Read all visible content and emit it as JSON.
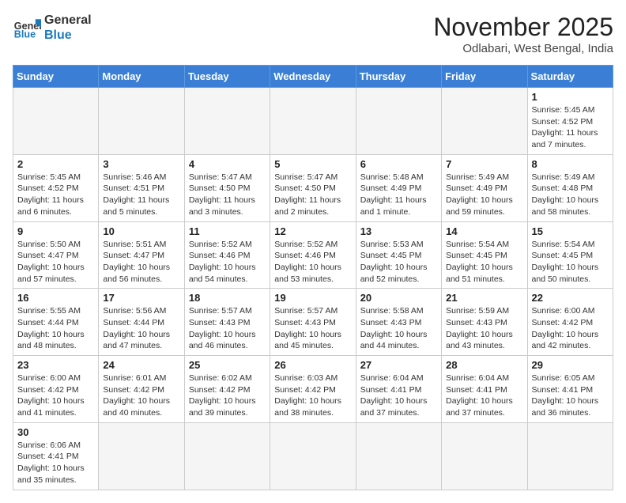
{
  "header": {
    "logo_general": "General",
    "logo_blue": "Blue",
    "month_title": "November 2025",
    "location": "Odlabari, West Bengal, India"
  },
  "weekdays": [
    "Sunday",
    "Monday",
    "Tuesday",
    "Wednesday",
    "Thursday",
    "Friday",
    "Saturday"
  ],
  "days": [
    {
      "num": "",
      "info": ""
    },
    {
      "num": "",
      "info": ""
    },
    {
      "num": "",
      "info": ""
    },
    {
      "num": "",
      "info": ""
    },
    {
      "num": "",
      "info": ""
    },
    {
      "num": "",
      "info": ""
    },
    {
      "num": "1",
      "info": "Sunrise: 5:45 AM\nSunset: 4:52 PM\nDaylight: 11 hours\nand 7 minutes."
    },
    {
      "num": "2",
      "info": "Sunrise: 5:45 AM\nSunset: 4:52 PM\nDaylight: 11 hours\nand 6 minutes."
    },
    {
      "num": "3",
      "info": "Sunrise: 5:46 AM\nSunset: 4:51 PM\nDaylight: 11 hours\nand 5 minutes."
    },
    {
      "num": "4",
      "info": "Sunrise: 5:47 AM\nSunset: 4:50 PM\nDaylight: 11 hours\nand 3 minutes."
    },
    {
      "num": "5",
      "info": "Sunrise: 5:47 AM\nSunset: 4:50 PM\nDaylight: 11 hours\nand 2 minutes."
    },
    {
      "num": "6",
      "info": "Sunrise: 5:48 AM\nSunset: 4:49 PM\nDaylight: 11 hours\nand 1 minute."
    },
    {
      "num": "7",
      "info": "Sunrise: 5:49 AM\nSunset: 4:49 PM\nDaylight: 10 hours\nand 59 minutes."
    },
    {
      "num": "8",
      "info": "Sunrise: 5:49 AM\nSunset: 4:48 PM\nDaylight: 10 hours\nand 58 minutes."
    },
    {
      "num": "9",
      "info": "Sunrise: 5:50 AM\nSunset: 4:47 PM\nDaylight: 10 hours\nand 57 minutes."
    },
    {
      "num": "10",
      "info": "Sunrise: 5:51 AM\nSunset: 4:47 PM\nDaylight: 10 hours\nand 56 minutes."
    },
    {
      "num": "11",
      "info": "Sunrise: 5:52 AM\nSunset: 4:46 PM\nDaylight: 10 hours\nand 54 minutes."
    },
    {
      "num": "12",
      "info": "Sunrise: 5:52 AM\nSunset: 4:46 PM\nDaylight: 10 hours\nand 53 minutes."
    },
    {
      "num": "13",
      "info": "Sunrise: 5:53 AM\nSunset: 4:45 PM\nDaylight: 10 hours\nand 52 minutes."
    },
    {
      "num": "14",
      "info": "Sunrise: 5:54 AM\nSunset: 4:45 PM\nDaylight: 10 hours\nand 51 minutes."
    },
    {
      "num": "15",
      "info": "Sunrise: 5:54 AM\nSunset: 4:45 PM\nDaylight: 10 hours\nand 50 minutes."
    },
    {
      "num": "16",
      "info": "Sunrise: 5:55 AM\nSunset: 4:44 PM\nDaylight: 10 hours\nand 48 minutes."
    },
    {
      "num": "17",
      "info": "Sunrise: 5:56 AM\nSunset: 4:44 PM\nDaylight: 10 hours\nand 47 minutes."
    },
    {
      "num": "18",
      "info": "Sunrise: 5:57 AM\nSunset: 4:43 PM\nDaylight: 10 hours\nand 46 minutes."
    },
    {
      "num": "19",
      "info": "Sunrise: 5:57 AM\nSunset: 4:43 PM\nDaylight: 10 hours\nand 45 minutes."
    },
    {
      "num": "20",
      "info": "Sunrise: 5:58 AM\nSunset: 4:43 PM\nDaylight: 10 hours\nand 44 minutes."
    },
    {
      "num": "21",
      "info": "Sunrise: 5:59 AM\nSunset: 4:43 PM\nDaylight: 10 hours\nand 43 minutes."
    },
    {
      "num": "22",
      "info": "Sunrise: 6:00 AM\nSunset: 4:42 PM\nDaylight: 10 hours\nand 42 minutes."
    },
    {
      "num": "23",
      "info": "Sunrise: 6:00 AM\nSunset: 4:42 PM\nDaylight: 10 hours\nand 41 minutes."
    },
    {
      "num": "24",
      "info": "Sunrise: 6:01 AM\nSunset: 4:42 PM\nDaylight: 10 hours\nand 40 minutes."
    },
    {
      "num": "25",
      "info": "Sunrise: 6:02 AM\nSunset: 4:42 PM\nDaylight: 10 hours\nand 39 minutes."
    },
    {
      "num": "26",
      "info": "Sunrise: 6:03 AM\nSunset: 4:42 PM\nDaylight: 10 hours\nand 38 minutes."
    },
    {
      "num": "27",
      "info": "Sunrise: 6:04 AM\nSunset: 4:41 PM\nDaylight: 10 hours\nand 37 minutes."
    },
    {
      "num": "28",
      "info": "Sunrise: 6:04 AM\nSunset: 4:41 PM\nDaylight: 10 hours\nand 37 minutes."
    },
    {
      "num": "29",
      "info": "Sunrise: 6:05 AM\nSunset: 4:41 PM\nDaylight: 10 hours\nand 36 minutes."
    },
    {
      "num": "30",
      "info": "Sunrise: 6:06 AM\nSunset: 4:41 PM\nDaylight: 10 hours\nand 35 minutes."
    },
    {
      "num": "",
      "info": ""
    },
    {
      "num": "",
      "info": ""
    },
    {
      "num": "",
      "info": ""
    },
    {
      "num": "",
      "info": ""
    },
    {
      "num": "",
      "info": ""
    },
    {
      "num": "",
      "info": ""
    }
  ]
}
